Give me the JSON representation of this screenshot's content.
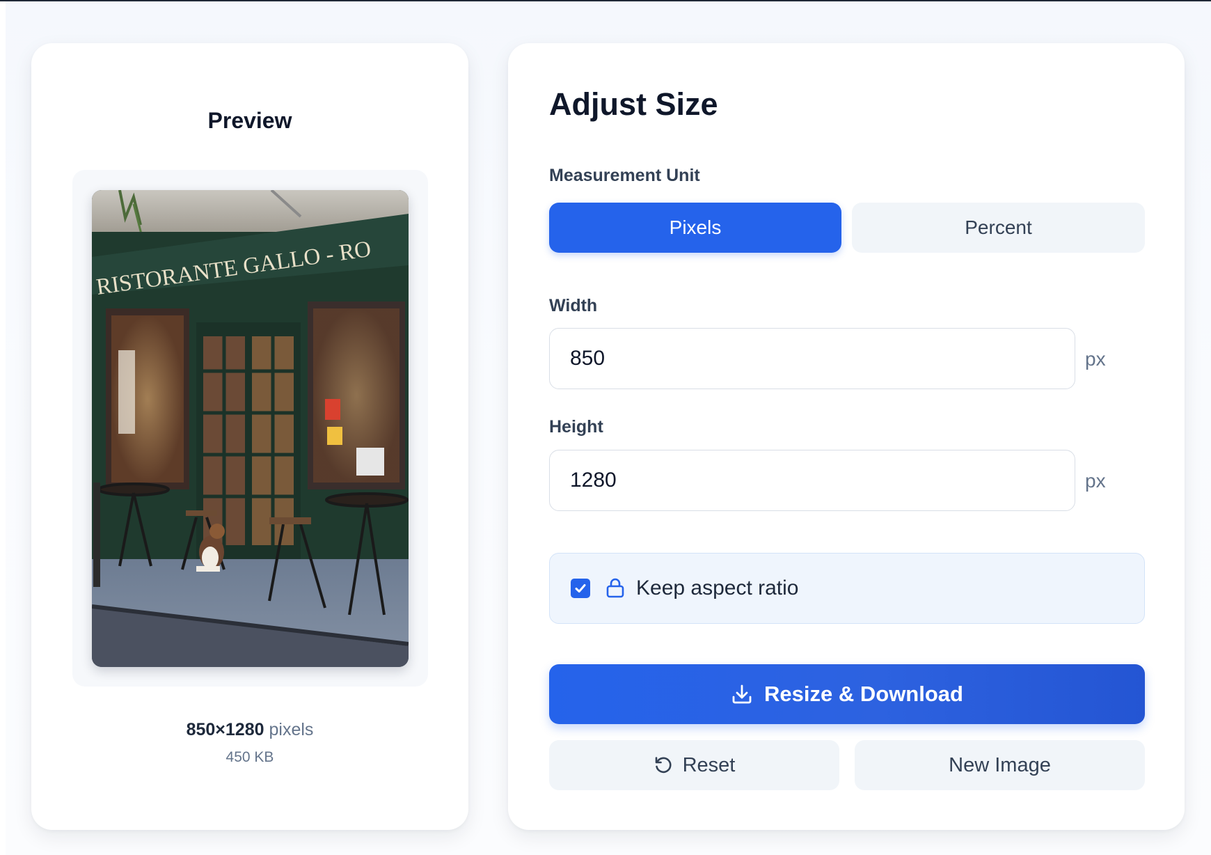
{
  "preview": {
    "title": "Preview",
    "image": {
      "signage_text": "RISTORANTE GALLO - RO"
    },
    "dimensions": "850×1280",
    "dimensions_unit": "pixels",
    "file_size": "450 KB"
  },
  "settings": {
    "title": "Adjust Size",
    "unit_label": "Measurement Unit",
    "units": [
      {
        "label": "Pixels",
        "active": true
      },
      {
        "label": "Percent",
        "active": false
      }
    ],
    "width": {
      "label": "Width",
      "value": "850",
      "unit": "px"
    },
    "height": {
      "label": "Height",
      "value": "1280",
      "unit": "px"
    },
    "aspect_ratio": {
      "label": "Keep aspect ratio",
      "checked": true
    },
    "primary_action": {
      "label": "Resize & Download",
      "icon": "download-icon"
    },
    "reset_action": {
      "label": "Reset",
      "icon": "reset-icon"
    },
    "new_image_action": {
      "label": "New Image"
    }
  },
  "colors": {
    "accent": "#2563eb",
    "secondary_button": "#f1f5f9",
    "ratio_box": "#eff5fd"
  }
}
